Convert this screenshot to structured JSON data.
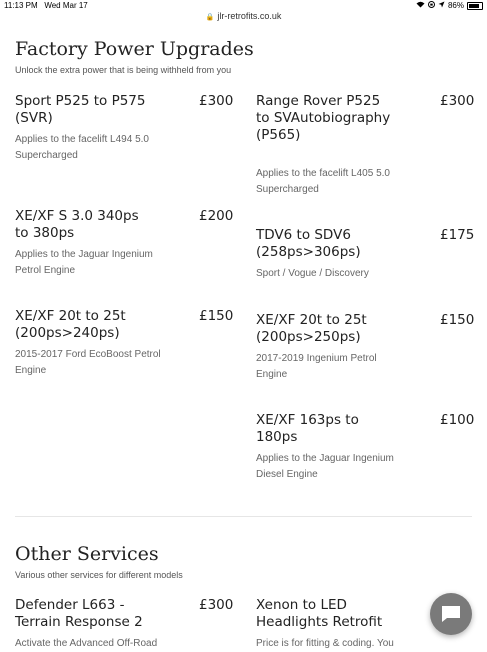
{
  "status": {
    "time": "11:13 PM",
    "date": "Wed Mar 17",
    "battery": "86%"
  },
  "url": "jlr-retrofits.co.uk",
  "factory": {
    "title": "Factory Power Upgrades",
    "subtitle": "Unlock the extra power that is being withheld from you",
    "items": [
      {
        "title": "Sport P525 to P575 (SVR)",
        "price": "£300",
        "desc": "Applies to the facelift L494 5.0 Supercharged"
      },
      {
        "title": "Range Rover P525 to SVAutobiography (P565)",
        "price": "£300",
        "desc": "Applies to the facelift L405 5.0 Supercharged"
      },
      {
        "title": "XE/XF S 3.0 340ps to 380ps",
        "price": "£200",
        "desc": "Applies to the Jaguar Ingenium Petrol Engine"
      },
      {
        "title": "TDV6 to SDV6 (258ps>306ps)",
        "price": "£175",
        "desc": "Sport / Vogue / Discovery"
      },
      {
        "title": "XE/XF 20t to 25t (200ps>240ps)",
        "price": "£150",
        "desc": "2015-2017 Ford EcoBoost Petrol Engine"
      },
      {
        "title": "XE/XF 20t to 25t (200ps>250ps)",
        "price": "£150",
        "desc": "2017-2019 Ingenium Petrol Engine"
      },
      {
        "title": "XE/XF 163ps to 180ps",
        "price": "£100",
        "desc": "Applies to the Jaguar Ingenium Diesel Engine"
      }
    ]
  },
  "other": {
    "title": "Other Services",
    "subtitle": "Various other services for different models",
    "items": [
      {
        "title": "Defender L663 - Terrain Response 2",
        "price": "£300",
        "desc": "Activate the Advanced Off-Road"
      },
      {
        "title": "Xenon to LED Headlights Retrofit",
        "price": "",
        "desc": "Price is for fitting & coding. You"
      }
    ]
  }
}
